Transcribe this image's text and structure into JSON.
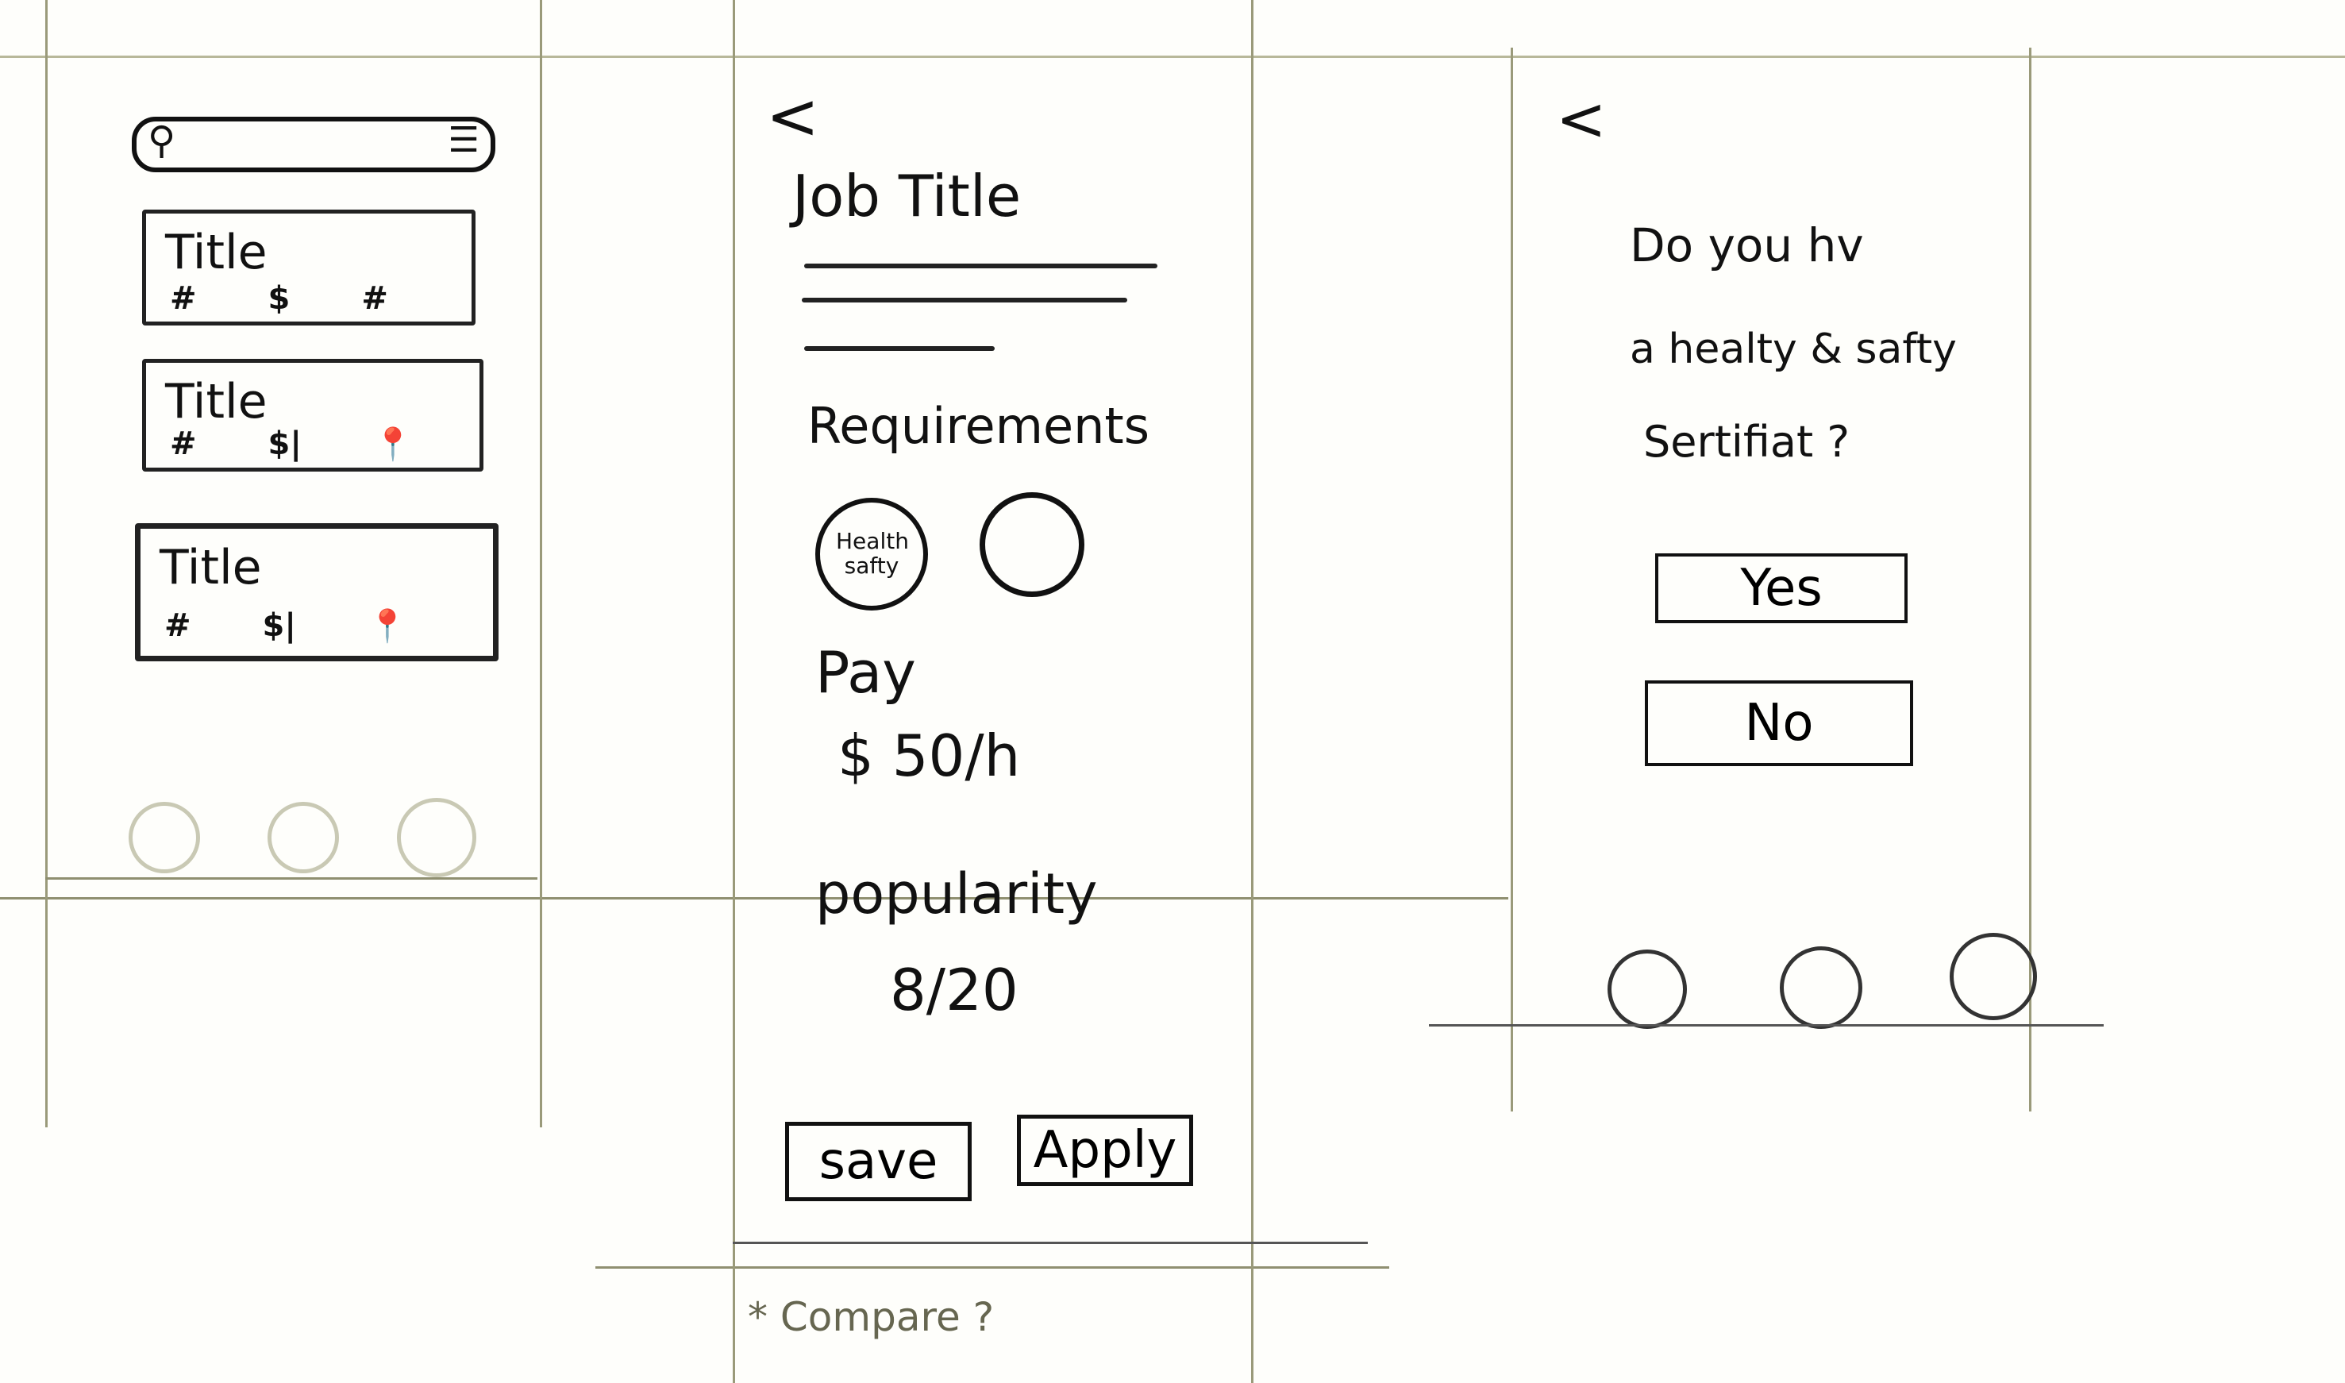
{
  "screen_list": {
    "search": {
      "placeholder": "",
      "search_icon": "search-icon",
      "filter_icon": "sliders-icon"
    },
    "cards": [
      {
        "title": "Title",
        "icons": [
          "#",
          "$",
          "#"
        ]
      },
      {
        "title": "Title",
        "icons": [
          "#",
          "$|",
          "📍"
        ]
      },
      {
        "title": "Title",
        "icons": [
          "#",
          "$|",
          "📍"
        ]
      }
    ],
    "nav_icons": [
      "circle-icon",
      "circle-icon",
      "circle-icon"
    ]
  },
  "screen_detail": {
    "back_icon": "chevron-left-icon",
    "back_glyph": "<",
    "job_title": "Job Title",
    "requirements_label": "Requirements",
    "requirement_badges": [
      "Health safty",
      ""
    ],
    "pay_label": "Pay",
    "pay_value": "$ 50/h",
    "popularity_label": "popularity",
    "popularity_value": "8/20",
    "save_label": "save",
    "apply_label": "Apply",
    "note": "* Compare ?"
  },
  "screen_question": {
    "back_glyph": "<",
    "question_lines": [
      "Do you hv",
      "a  healty & safty",
      "Sertifiat ?"
    ],
    "yes_label": "Yes",
    "no_label": "No",
    "nav_icons": [
      "circle-icon",
      "circle-icon",
      "circle-icon"
    ]
  },
  "colors": {
    "paper": "#fefefb",
    "pencil": "#9a9a7a",
    "ink": "#111111"
  }
}
